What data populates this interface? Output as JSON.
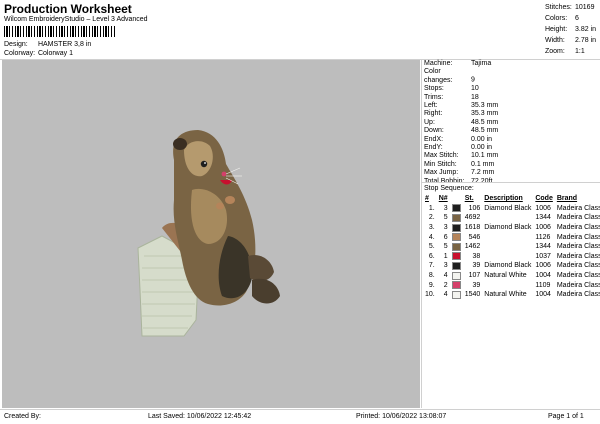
{
  "header": {
    "title": "Production Worksheet",
    "subtitle": "Wilcom EmbroideryStudio – Level 3 Advanced",
    "design_label": "Design:",
    "design_value": "HAMSTER 3,8 in",
    "colorway_label": "Colorway:",
    "colorway_value": "Colorway 1"
  },
  "stats": [
    {
      "label": "Stitches:",
      "value": "10169"
    },
    {
      "label": "Colors:",
      "value": "6"
    },
    {
      "label": "Height:",
      "value": "3.82 in"
    },
    {
      "label": "Width:",
      "value": "2.78 in"
    },
    {
      "label": "Zoom:",
      "value": "1:1"
    }
  ],
  "properties": [
    {
      "label": "Machine:",
      "value": "Tajima"
    },
    {
      "label": "Color changes:",
      "value": "9"
    },
    {
      "label": "Stops:",
      "value": "10"
    },
    {
      "label": "Trims:",
      "value": "18"
    },
    {
      "label": "Left:",
      "value": "35.3 mm"
    },
    {
      "label": "Right:",
      "value": "35.3 mm"
    },
    {
      "label": "Up:",
      "value": "48.5 mm"
    },
    {
      "label": "Down:",
      "value": "48.5 mm"
    },
    {
      "label": "EndX:",
      "value": "0.00 in"
    },
    {
      "label": "EndY:",
      "value": "0.00 in"
    },
    {
      "label": "Max Stitch:",
      "value": "10.1 mm"
    },
    {
      "label": "Min Stitch:",
      "value": "0.1 mm"
    },
    {
      "label": "Max Jump:",
      "value": "7.2 mm"
    },
    {
      "label": "Total Bobbin:",
      "value": "72.20ft"
    }
  ],
  "sequence": {
    "title": "Stop Sequence:",
    "headers": [
      "#",
      "N#",
      "",
      "St.",
      "Description",
      "Code",
      "Brand"
    ],
    "rows": [
      {
        "idx": "1.",
        "n": "3",
        "color": "#1e1e1e",
        "st": "106",
        "desc": "Diamond Black",
        "code": "1006",
        "brand": "Madeira Classic 40"
      },
      {
        "idx": "2.",
        "n": "5",
        "color": "#7a6444",
        "st": "4692",
        "desc": "",
        "code": "1344",
        "brand": "Madeira Classic 40"
      },
      {
        "idx": "3.",
        "n": "3",
        "color": "#1e1e1e",
        "st": "1618",
        "desc": "Diamond Black",
        "code": "1006",
        "brand": "Madeira Classic 40"
      },
      {
        "idx": "4.",
        "n": "6",
        "color": "#b5845a",
        "st": "546",
        "desc": "",
        "code": "1126",
        "brand": "Madeira Classic 40"
      },
      {
        "idx": "5.",
        "n": "5",
        "color": "#7a6444",
        "st": "1462",
        "desc": "",
        "code": "1344",
        "brand": "Madeira Classic 40"
      },
      {
        "idx": "6.",
        "n": "1",
        "color": "#c8102e",
        "st": "38",
        "desc": "",
        "code": "1037",
        "brand": "Madeira Classic 40"
      },
      {
        "idx": "7.",
        "n": "3",
        "color": "#1e1e1e",
        "st": "39",
        "desc": "Diamond Black",
        "code": "1006",
        "brand": "Madeira Classic 40"
      },
      {
        "idx": "8.",
        "n": "4",
        "color": "#f4f4f0",
        "st": "107",
        "desc": "Natural White",
        "code": "1004",
        "brand": "Madeira Classic 40"
      },
      {
        "idx": "9.",
        "n": "2",
        "color": "#d4406a",
        "st": "39",
        "desc": "",
        "code": "1109",
        "brand": "Madeira Classic 40"
      },
      {
        "idx": "10.",
        "n": "4",
        "color": "#f4f4f0",
        "st": "1540",
        "desc": "Natural White",
        "code": "1004",
        "brand": "Madeira Classic 40"
      }
    ]
  },
  "footer": {
    "created_by": "Created By:",
    "last_saved": "Last Saved: 10/06/2022 12:45:42",
    "printed": "Printed: 10/06/2022 13:08:07",
    "page": "Page 1 of 1"
  },
  "colors": {
    "design_background": "#bdbdbd",
    "fur_main": "#7a6444",
    "fur_light": "#b59a6e",
    "fur_dark": "#3a3428",
    "hand": "#9a7452",
    "paper": "#d6dccb"
  }
}
